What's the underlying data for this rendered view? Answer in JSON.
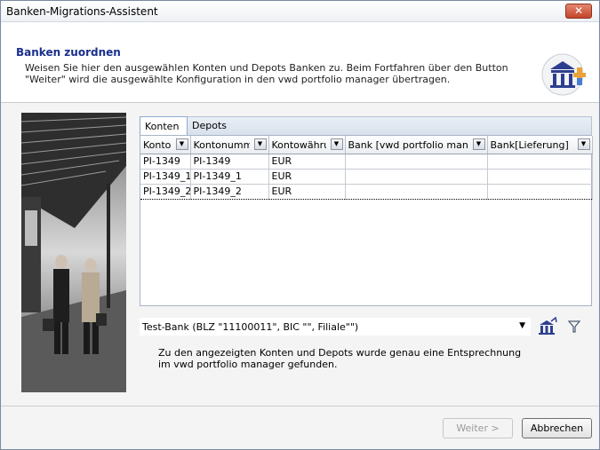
{
  "window": {
    "title": "Banken-Migrations-Assistent",
    "close_label": "✕"
  },
  "header": {
    "title": "Banken zuordnen",
    "description": "Weisen Sie hier den ausgewählen Konten und Depots Banken zu. Beim Fortfahren über den Button \"Weiter\" wird die ausgewählte Konfiguration in den vwd portfolio manager übertragen."
  },
  "tabs": [
    {
      "label": "Konten",
      "active": true
    },
    {
      "label": "Depots",
      "active": false
    }
  ],
  "table": {
    "columns": [
      "Konto",
      "Kontonumme",
      "Kontowährur",
      "Bank [vwd portfolio manag",
      "Bank[Lieferung]"
    ],
    "rows": [
      [
        "PI-1349",
        "PI-1349",
        "EUR",
        "",
        ""
      ],
      [
        "PI-1349_1",
        "PI-1349_1",
        "EUR",
        "",
        ""
      ],
      [
        "PI-1349_2",
        "PI-1349_2",
        "EUR",
        "",
        ""
      ]
    ]
  },
  "bank_select": {
    "value": "Test-Bank (BLZ \"11100011\", BIC \"\", Filiale\"\")"
  },
  "message": {
    "line1": "Zu den angezeigten Konten und Depots wurde genau eine Entsprechnung",
    "line2": "im vwd portfolio manager gefunden."
  },
  "buttons": {
    "next": "Weiter >",
    "cancel": "Abbrechen"
  },
  "colors": {
    "header_title": "#1a2f8c",
    "close": "#c3452a"
  }
}
